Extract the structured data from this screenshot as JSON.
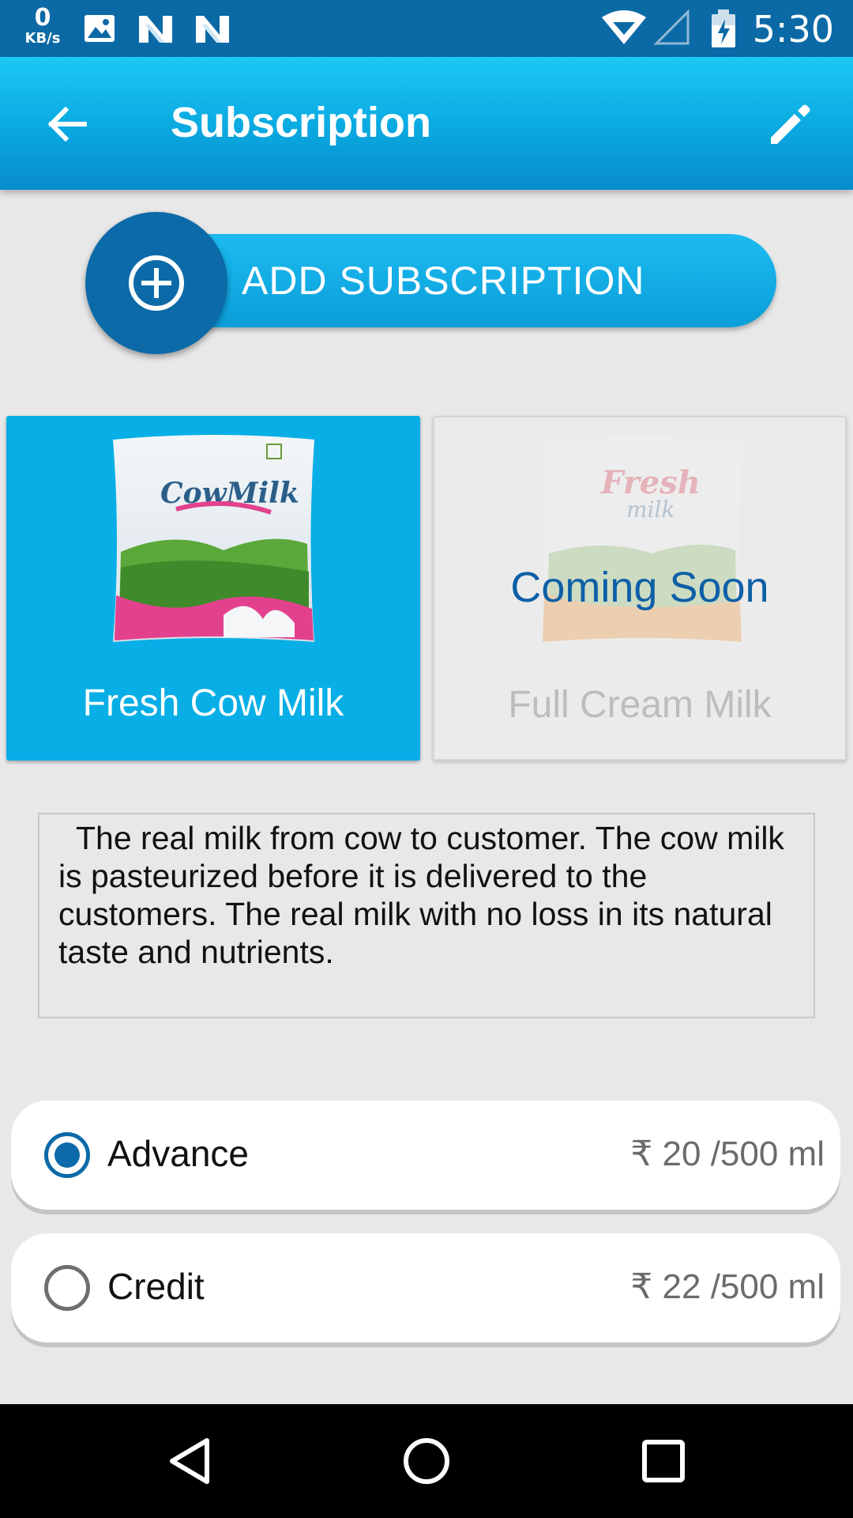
{
  "status_bar": {
    "net_speed_value": "0",
    "net_speed_unit": "KB/s",
    "time": "5:30",
    "icons": [
      "image-icon",
      "n-app-icon",
      "n-app-icon",
      "wifi-icon",
      "signal-icon",
      "battery-icon"
    ]
  },
  "app_bar": {
    "title": "Subscription",
    "back_icon": "arrow-back-icon",
    "edit_icon": "pencil-icon"
  },
  "add_subscription": {
    "label": "ADD SUBSCRIPTION",
    "icon": "plus-circle-icon"
  },
  "products": [
    {
      "name": "Fresh Cow Milk",
      "selected": true,
      "image": "cow-milk-pack"
    },
    {
      "name": "Full Cream Milk",
      "selected": false,
      "badge": "Coming Soon",
      "image": "fresh-milk-pack"
    }
  ],
  "description": "The real milk from cow to customer. The cow milk is pasteurized before it is delivered to the customers. The real milk with no loss in its natural taste and nutrients.",
  "payment_options": [
    {
      "label": "Advance",
      "price": "₹ 20 /500 ml",
      "checked": true
    },
    {
      "label": "Credit",
      "price": "₹ 22 /500 ml",
      "checked": false
    }
  ],
  "colors": {
    "status_bar": "#0b6aa6",
    "app_bar": "#0aa8e0",
    "accent_dark": "#0c6aa8",
    "card_selected": "#08aee6",
    "coming_soon_text": "#0d5fa6"
  }
}
